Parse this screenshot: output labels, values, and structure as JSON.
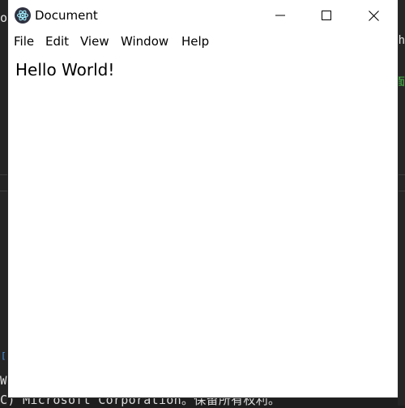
{
  "window": {
    "title": "Document",
    "icon": "electron-atom-icon",
    "controls": {
      "minimize": "minimize-icon",
      "maximize": "maximize-icon",
      "close": "close-icon"
    }
  },
  "menu": {
    "items": [
      {
        "label": "File"
      },
      {
        "label": "Edit"
      },
      {
        "label": "View"
      },
      {
        "label": "Window"
      },
      {
        "label": "Help"
      }
    ]
  },
  "content": {
    "heading": "Hello World!"
  },
  "background_terminal": {
    "left_glyph": "o",
    "right_glyph": "h",
    "right_green_glyph": "面",
    "left_bracket_glyph": "[",
    "left_w_glyph": "W",
    "bottom_line": "C) Microsoft Corporation。保留所有权利。"
  },
  "colors": {
    "terminal_bg": "#1e1e1e",
    "window_bg": "#ffffff",
    "icon_dark": "#2f3241",
    "icon_accent": "#9feaf9",
    "terminal_green": "#4ec94e"
  }
}
